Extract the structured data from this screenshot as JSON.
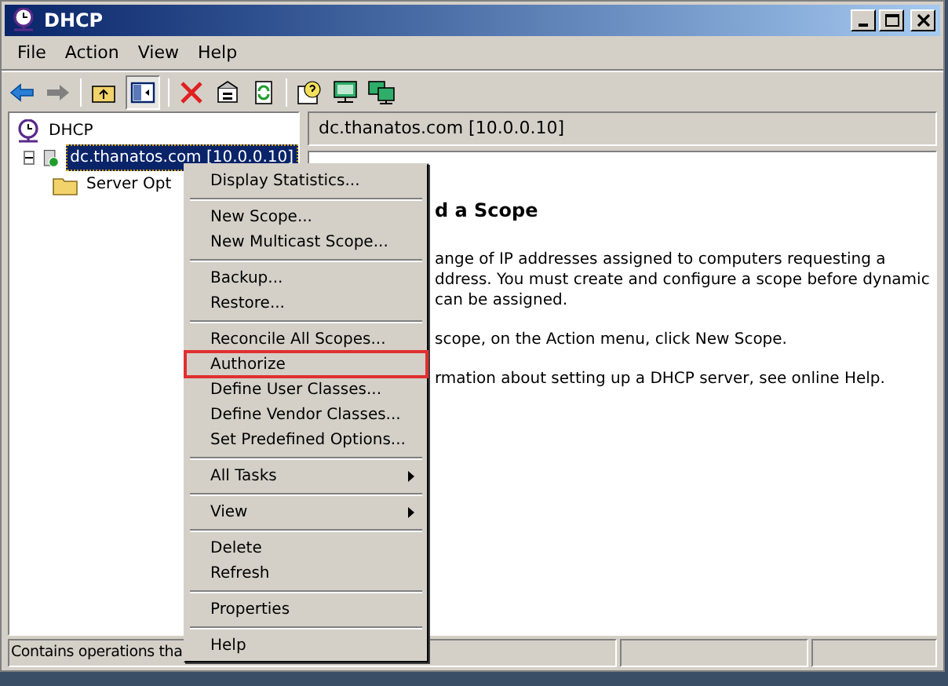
{
  "window": {
    "title": "DHCP"
  },
  "menu_bar": [
    "File",
    "Action",
    "View",
    "Help"
  ],
  "toolbar": [
    {
      "kind": "back",
      "disabled": false
    },
    {
      "kind": "forward",
      "disabled": true
    },
    {
      "kind": "up",
      "disabled": false
    },
    {
      "kind": "tree",
      "disabled": false
    },
    {
      "kind": "delete",
      "disabled": false
    },
    {
      "kind": "properties",
      "disabled": false
    },
    {
      "kind": "refresh",
      "disabled": false
    },
    {
      "kind": "help",
      "disabled": false
    },
    {
      "kind": "server",
      "disabled": false
    },
    {
      "kind": "servers",
      "disabled": false
    }
  ],
  "tree": {
    "items": [
      {
        "label": "DHCP",
        "kind": "root",
        "selected": false,
        "expanded": true,
        "children": [
          {
            "label": "dc.thanatos.com [10.0.0.10]",
            "kind": "server",
            "selected": true,
            "expanded": true,
            "children": [
              {
                "label": "Server Opt",
                "kind": "folder",
                "selected": false
              }
            ]
          }
        ]
      }
    ]
  },
  "details": {
    "header": "dc.thanatos.com [10.0.0.10]",
    "heading": "d a Scope",
    "paragraphs": [
      "ange of IP addresses assigned to computers requesting a\nddress. You must create and configure a scope before dynamic\ncan be assigned.",
      "scope, on the Action menu, click New Scope.",
      "rmation about setting up a DHCP server, see online Help."
    ]
  },
  "context_menu": [
    {
      "kind": "item",
      "label": "Display Statistics...",
      "outlined": false
    },
    {
      "kind": "separator"
    },
    {
      "kind": "item",
      "label": "New Scope...",
      "outlined": false
    },
    {
      "kind": "item",
      "label": "New Multicast Scope...",
      "outlined": false
    },
    {
      "kind": "separator"
    },
    {
      "kind": "item",
      "label": "Backup...",
      "outlined": false
    },
    {
      "kind": "item",
      "label": "Restore...",
      "outlined": false
    },
    {
      "kind": "separator"
    },
    {
      "kind": "item",
      "label": "Reconcile All Scopes...",
      "outlined": false
    },
    {
      "kind": "item",
      "label": "Authorize",
      "outlined": true
    },
    {
      "kind": "item",
      "label": "Define User Classes...",
      "outlined": false
    },
    {
      "kind": "item",
      "label": "Define Vendor Classes...",
      "outlined": false
    },
    {
      "kind": "item",
      "label": "Set Predefined Options...",
      "outlined": false
    },
    {
      "kind": "separator"
    },
    {
      "kind": "submenu",
      "label": "All Tasks",
      "outlined": false
    },
    {
      "kind": "separator"
    },
    {
      "kind": "submenu",
      "label": "View",
      "outlined": false
    },
    {
      "kind": "separator"
    },
    {
      "kind": "item",
      "label": "Delete",
      "outlined": false
    },
    {
      "kind": "item",
      "label": "Refresh",
      "outlined": false
    },
    {
      "kind": "separator"
    },
    {
      "kind": "item",
      "label": "Properties",
      "outlined": false
    },
    {
      "kind": "separator"
    },
    {
      "kind": "item",
      "label": "Help",
      "outlined": false
    }
  ],
  "status_bar": {
    "text": "Contains operations tha"
  }
}
